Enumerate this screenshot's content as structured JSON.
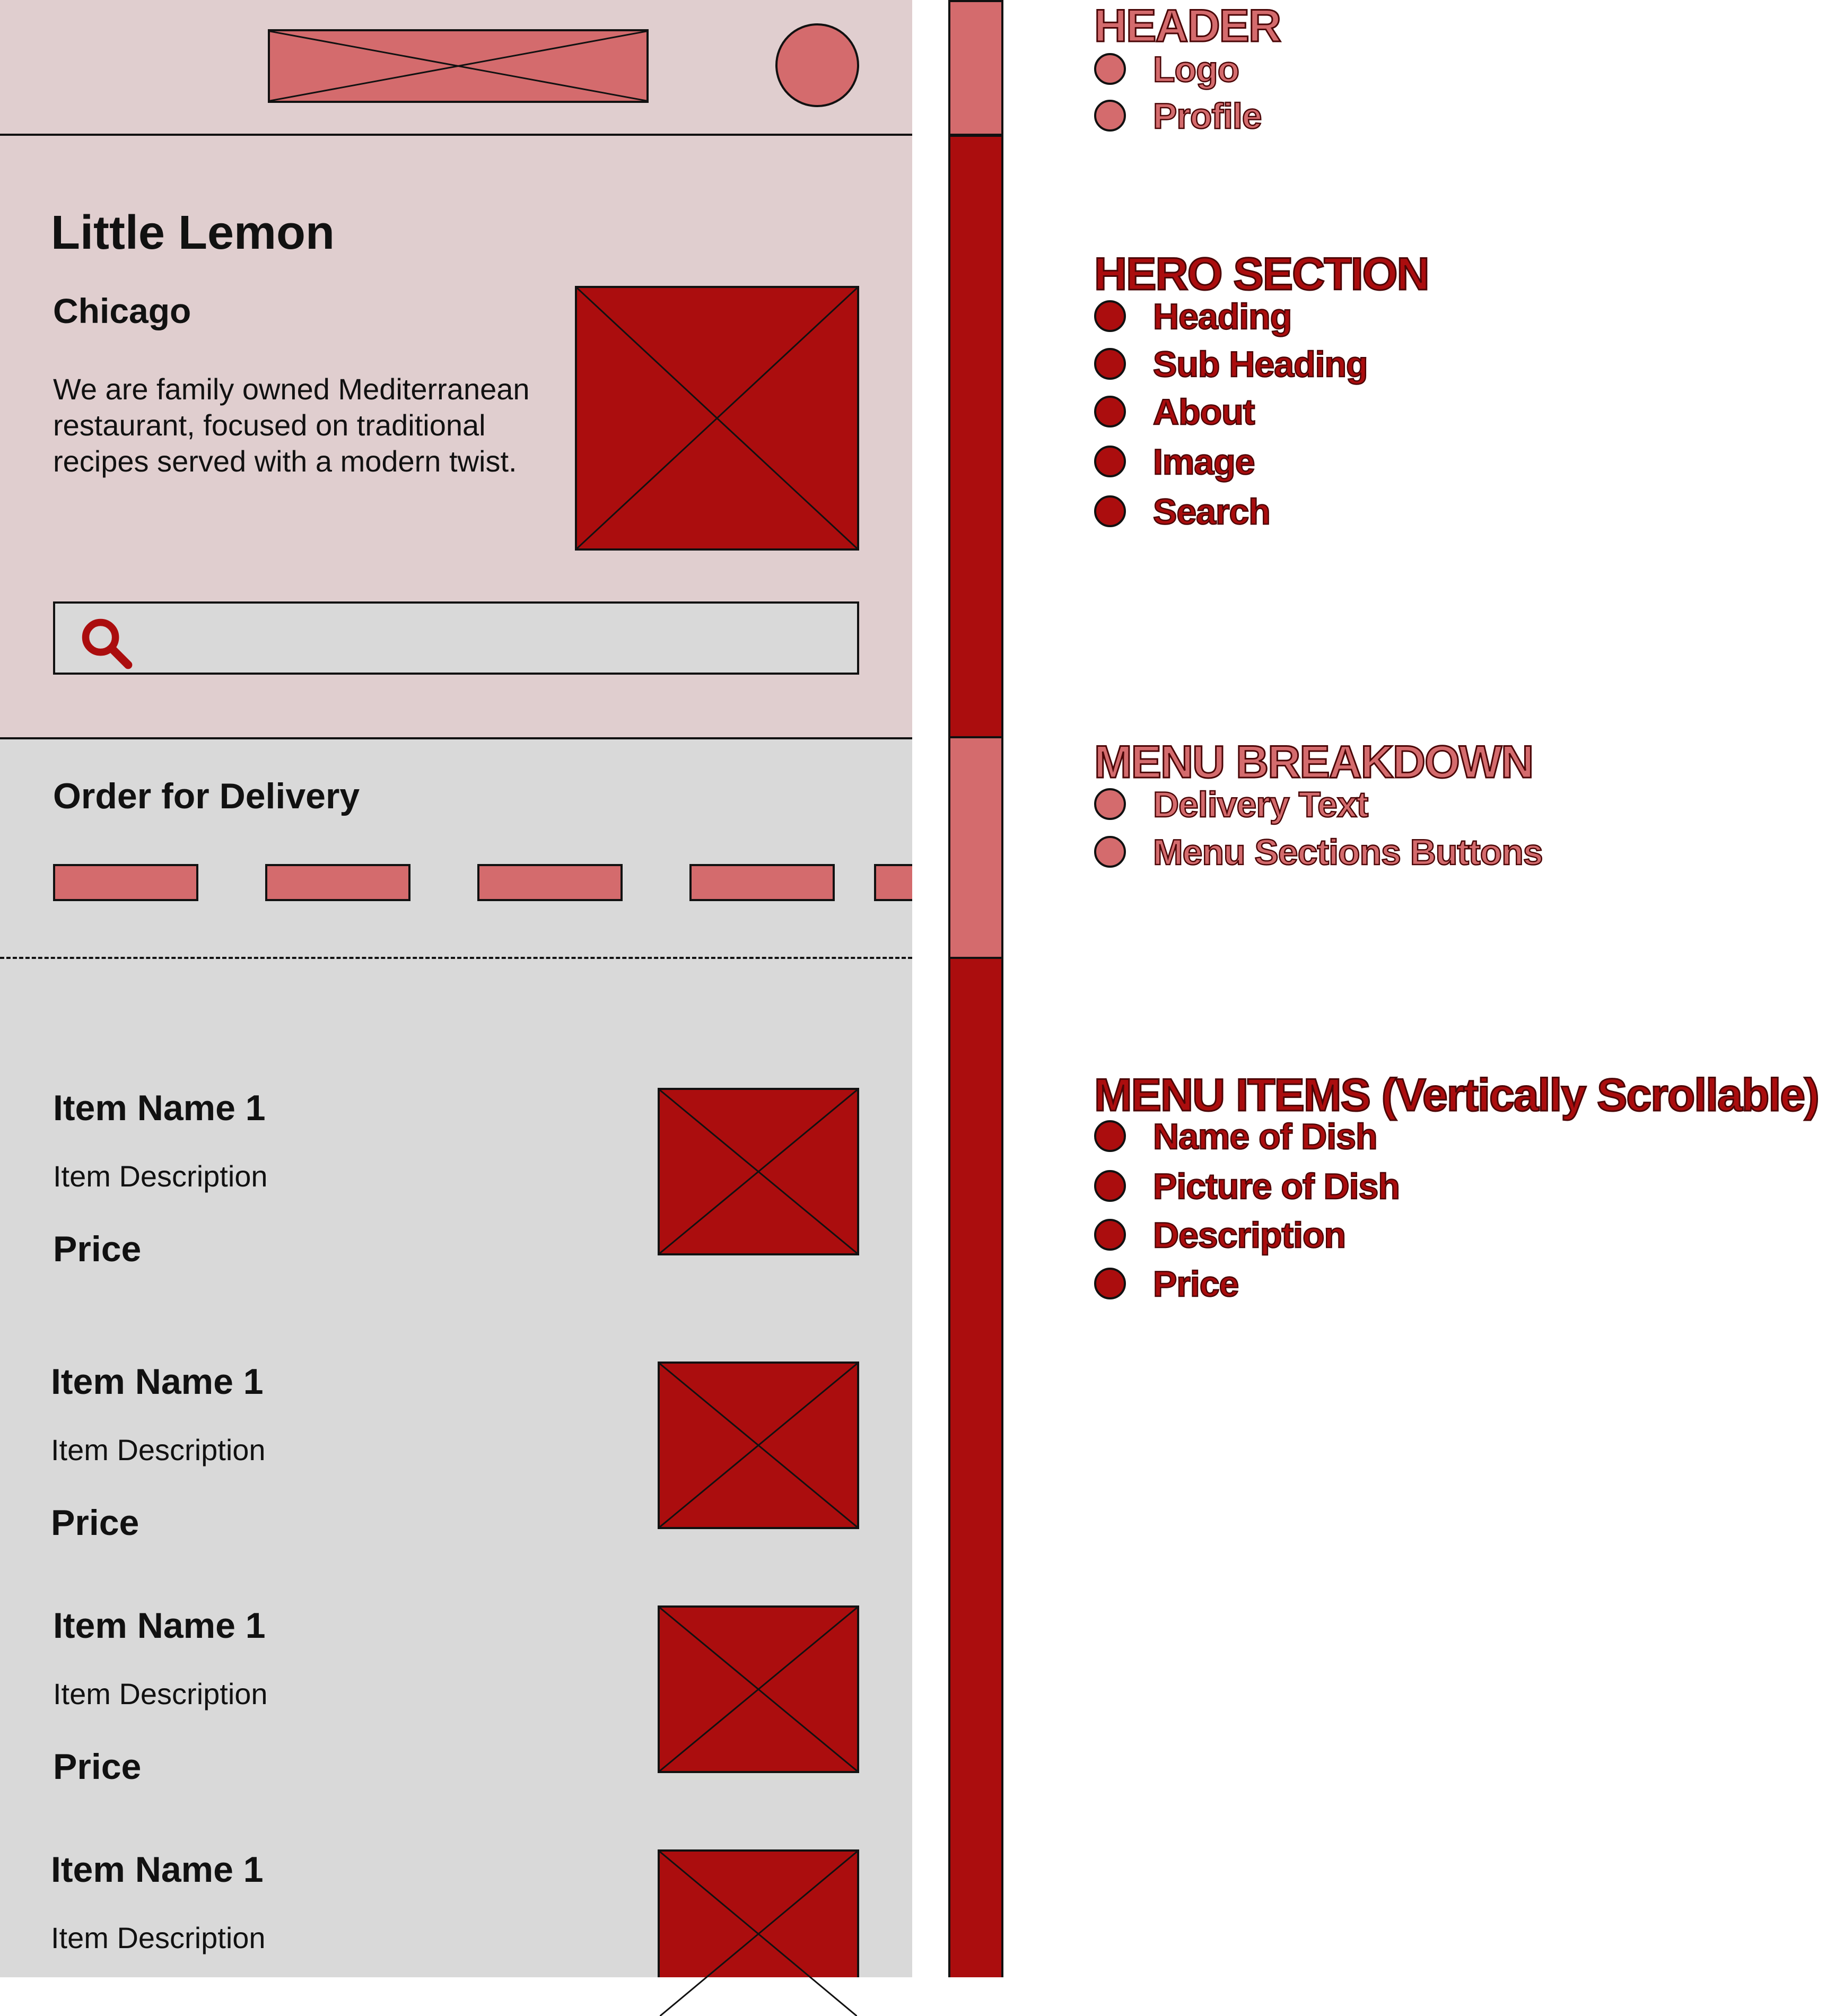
{
  "colors": {
    "light_accent": "#d46b6d",
    "dark_accent": "#ab0d0e",
    "hero_bg": "#e0cecf",
    "menu_bg": "#d9d9d9",
    "outline": "#111111"
  },
  "wireframe": {
    "header": {
      "logo": "image-placeholder",
      "profile": "avatar-placeholder"
    },
    "hero": {
      "heading": "Little Lemon",
      "sub_heading": "Chicago",
      "about": "We are family owned Mediterranean restaurant, focused on traditional recipes served with a modern twist.",
      "image": "image-placeholder",
      "search_icon": "search-icon"
    },
    "menu_breakdown": {
      "delivery_text": "Order for Delivery",
      "category_button_count": 5
    },
    "menu_items": [
      {
        "name": "Item Name 1",
        "description": "Item Description",
        "price": "Price"
      },
      {
        "name": "Item Name 1",
        "description": "Item Description",
        "price": "Price"
      },
      {
        "name": "Item Name 1",
        "description": "Item Description",
        "price": "Price"
      },
      {
        "name": "Item Name 1",
        "description": "Item Description"
      }
    ]
  },
  "annotations": [
    {
      "title": "HEADER",
      "items": [
        "Logo",
        "Profile"
      ]
    },
    {
      "title": "HERO SECTION",
      "items": [
        "Heading",
        "Sub Heading",
        "About",
        "Image",
        "Search"
      ]
    },
    {
      "title": "MENU BREAKDOWN",
      "items": [
        "Delivery Text",
        "Menu Sections Buttons"
      ]
    },
    {
      "title": "MENU ITEMS (Vertically Scrollable)",
      "items": [
        "Name of Dish",
        "Picture of Dish",
        "Description",
        "Price"
      ]
    }
  ]
}
